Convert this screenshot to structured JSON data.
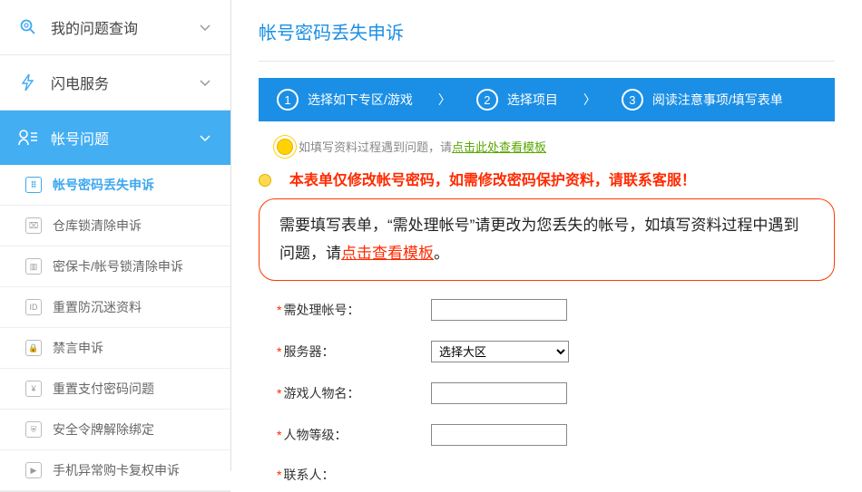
{
  "sidebar": {
    "sections": [
      {
        "label": "我的问题查询"
      },
      {
        "label": "闪电服务"
      },
      {
        "label": "帐号问题"
      }
    ],
    "accountItems": [
      {
        "label": "帐号密码丢失申诉"
      },
      {
        "label": "仓库锁清除申诉"
      },
      {
        "label": "密保卡/帐号锁清除申诉"
      },
      {
        "label": "重置防沉迷资料"
      },
      {
        "label": "禁言申诉"
      },
      {
        "label": "重置支付密码问题"
      },
      {
        "label": "安全令牌解除绑定"
      },
      {
        "label": "手机异常购卡复权申诉"
      }
    ]
  },
  "page": {
    "title": "帐号密码丢失申诉"
  },
  "steps": {
    "s1": {
      "num": "1",
      "label": "选择如下专区/游戏"
    },
    "s2": {
      "num": "2",
      "label": "选择项目"
    },
    "s3": {
      "num": "3",
      "label": "阅读注意事项/填写表单"
    }
  },
  "tip": {
    "prefix": "如填写资料过程遇到问题，请",
    "link": "点击此处查看模板"
  },
  "warn": "本表单仅修改帐号密码，如需修改密码保护资料，请联系客服！",
  "notice": {
    "pre": "需要填写表单，“需处理帐号”请更改为您丢失的帐号，如填写资料过程中遇到问题，请",
    "link": "点击查看模板",
    "post": "。"
  },
  "form": {
    "f1": "需处理帐号：",
    "f2": "服务器：",
    "f2_placeholder": "选择大区",
    "f3": "游戏人物名：",
    "f4": "人物等级：",
    "f5": "联系人："
  }
}
